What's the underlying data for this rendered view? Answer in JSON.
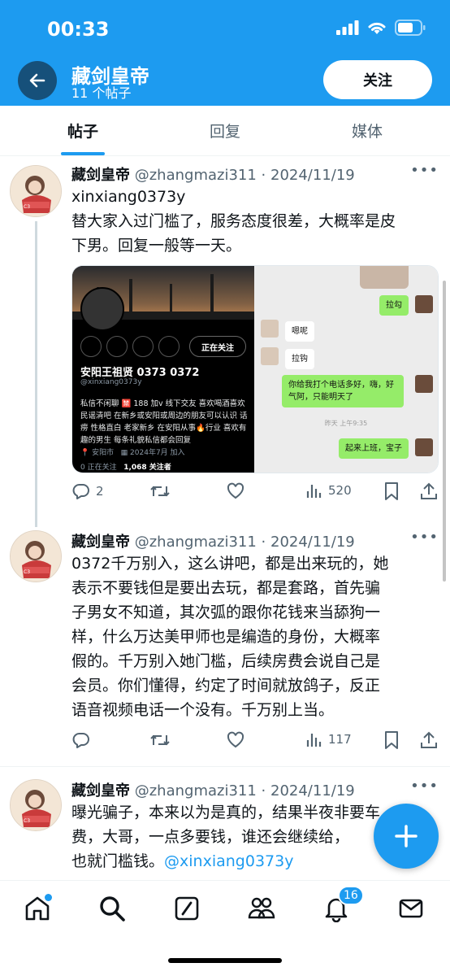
{
  "status_bar": {
    "time": "00:33"
  },
  "header": {
    "title": "藏剑皇帝",
    "subtitle": "11 个帖子",
    "follow_label": "关注"
  },
  "tabs": [
    {
      "label": "帖子",
      "active": true
    },
    {
      "label": "回复",
      "active": false
    },
    {
      "label": "媒体",
      "active": false
    }
  ],
  "posts": [
    {
      "name": "藏剑皇帝",
      "meta": "@zhangmazi311 · 2024/11/19",
      "text_lines": [
        "xinxiang0373y",
        "替大家入过门槛了，服务态度很差，大概率是皮",
        "下男。回复一般等一天。"
      ],
      "replies": "2",
      "views": "520"
    },
    {
      "name": "藏剑皇帝",
      "meta": "@zhangmazi311 · 2024/11/19",
      "text_lines": [
        "0372千万别入，这么讲吧，都是出来玩的，她",
        "表示不要钱但是要出去玩，都是套路，首先骗",
        "子男女不知道，其次弧的跟你花钱来当舔狗一",
        "样，什么万达美甲师也是编造的身份，大概率",
        "假的。千万别入她门槛，后续房费会说自己是",
        "会员。你们懂得，约定了时间就放鸽子，反正",
        "语音视频电话一个没有。千万别上当。"
      ],
      "replies": "",
      "views": "117"
    },
    {
      "name": "藏剑皇帝",
      "meta": "@zhangmazi311 · 2024/11/19",
      "text_lines": [
        "曝光骗子，本来以为是真的，结果半夜非要车",
        "费，大哥，一点多要钱，谁还会继续给，",
        "也就门槛钱。"
      ],
      "mention": "@xinxiang0373y"
    }
  ],
  "media": {
    "profile": {
      "follow_label": "正在关注",
      "name": "安阳王祖贤 0373 0372",
      "handle": "@xinxiang0373y",
      "bio": "私信不闲聊 🈲 188 加v 线下交友 喜欢喝酒喜欢民谣清吧 在新乡或安阳或周边的朋友可以认识 话痨 性格直白 老家新乡 在安阳从事🔥行业 喜欢有趣的男生 每条礼貌私信都会回复",
      "location": "安阳市",
      "joined": "2024年7月 加入",
      "following": "0 正在关注",
      "followers": "1,068 关注者"
    },
    "chat": [
      {
        "side": "right",
        "text": "拉勾"
      },
      {
        "side": "left",
        "text": "嗯呢"
      },
      {
        "side": "left",
        "text": "拉钩"
      },
      {
        "side": "right",
        "text": "你给我打个电话多好，嗨，好气阿，只能明天了"
      },
      {
        "side": "time",
        "text": "昨天 上午9:35"
      },
      {
        "side": "right",
        "text": "起来上班，宝子"
      }
    ]
  },
  "bottom_nav": {
    "notifications_badge": "16"
  }
}
